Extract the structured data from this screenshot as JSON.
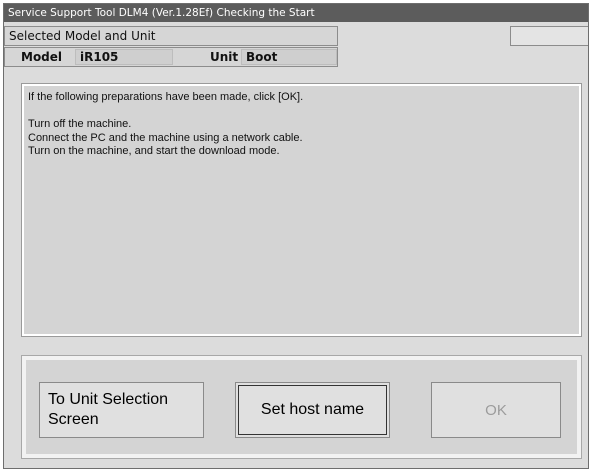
{
  "window": {
    "title": "Service Support Tool DLM4 (Ver.1.28Ef) Checking the Start"
  },
  "selection": {
    "header": "Selected Model and Unit",
    "model_label": "Model",
    "model_value": "iR105",
    "unit_label": "Unit",
    "unit_value": "Boot"
  },
  "message": {
    "lines": [
      "If the following preparations have been made, click [OK].",
      "",
      "Turn off the machine.",
      "Connect the PC and the machine using a network cable.",
      "Turn on the machine, and start the download mode."
    ]
  },
  "buttons": {
    "unit_selection_line1": "To Unit Selection",
    "unit_selection_line2": "Screen",
    "set_host_name": "Set host name",
    "ok": "OK",
    "ok_enabled": false
  }
}
